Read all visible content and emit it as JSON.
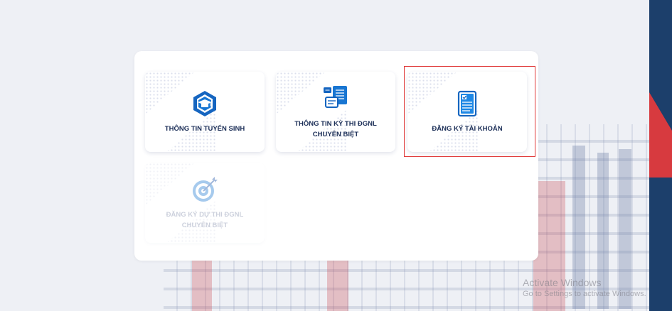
{
  "cards": [
    {
      "label": "THÔNG TIN TUYỂN SINH",
      "icon": "graduation-hexagon-icon",
      "enabled": true,
      "selected": false
    },
    {
      "label_line1": "THÔNG TIN KỲ THI ĐGNL",
      "label_line2": "CHUYÊN BIỆT",
      "icon": "document-chat-icon",
      "enabled": true,
      "selected": false
    },
    {
      "label": "ĐĂNG KÝ TÀI KHOẢN",
      "icon": "clipboard-checklist-icon",
      "enabled": true,
      "selected": true
    },
    {
      "label_line1": "ĐĂNG KÝ DỰ THI ĐGNL",
      "label_line2": "CHUYÊN BIỆT",
      "icon": "target-arrow-icon",
      "enabled": false,
      "selected": false
    }
  ],
  "watermark": {
    "line1": "Activate Windows",
    "line2": "Go to Settings to activate Windows."
  },
  "colors": {
    "primary": "#1565c0",
    "label": "#1b2e57",
    "highlight": "#e03b3b",
    "band_blue": "#1c3f6b",
    "band_red": "#d73a3f"
  }
}
